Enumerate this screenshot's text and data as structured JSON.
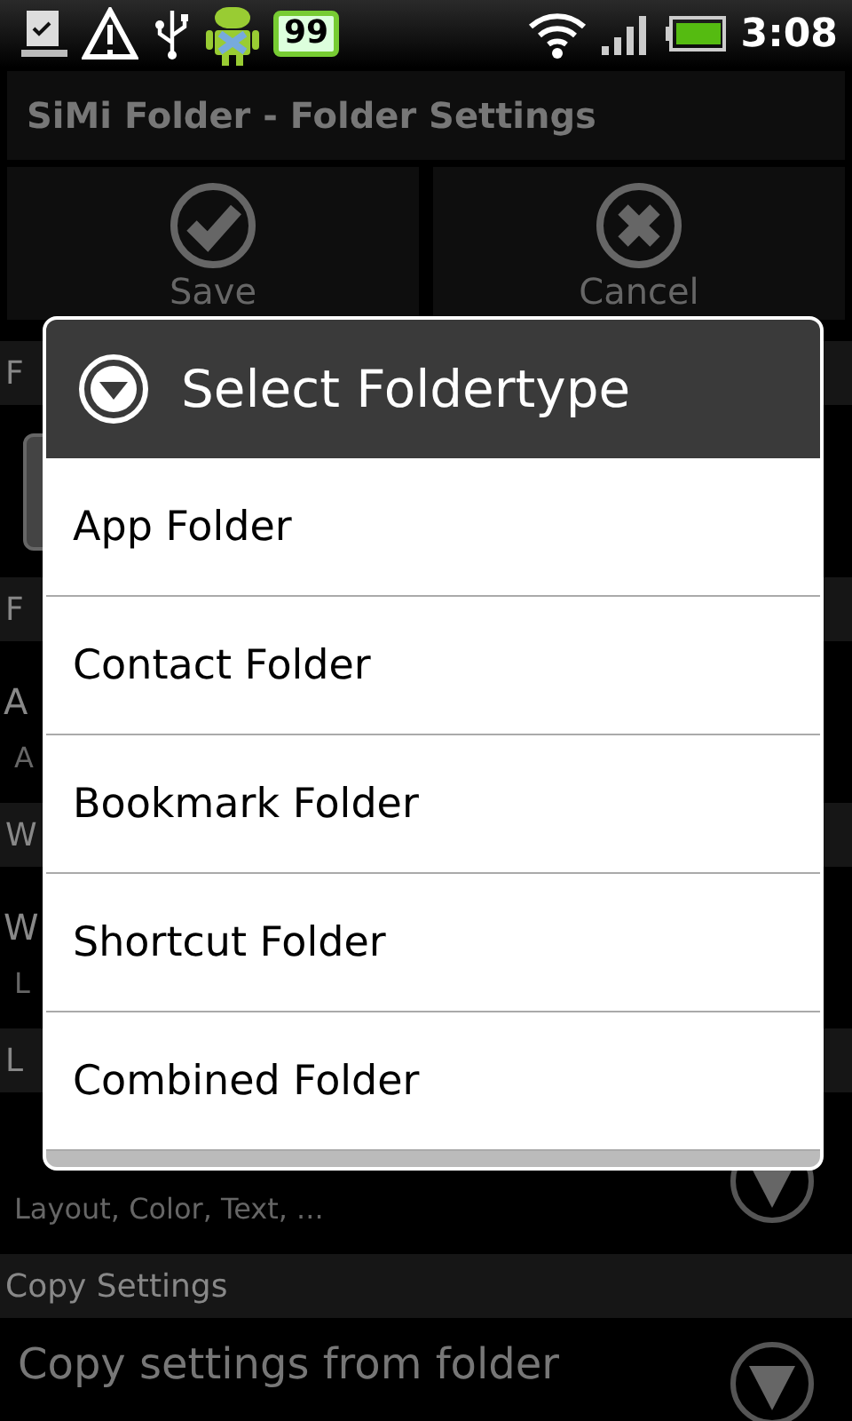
{
  "status_bar": {
    "battery_badge": "99",
    "time": "3:08"
  },
  "title": "SiMi Folder - Folder Settings",
  "actions": [
    {
      "kind": "save",
      "label": "Save"
    },
    {
      "kind": "cancel",
      "label": "Cancel"
    }
  ],
  "sections": [
    {
      "header": "F",
      "rows": [
        {
          "kind": "field"
        }
      ]
    },
    {
      "header": "F",
      "rows": [
        {
          "kind": "text",
          "title": "A",
          "summary": "A"
        }
      ]
    },
    {
      "header": "W",
      "rows": [
        {
          "kind": "text",
          "title": "W",
          "summary": "L"
        }
      ]
    },
    {
      "header": "L",
      "rows": [
        {
          "kind": "dropdown",
          "summary": "Layout, Color, Text, ..."
        }
      ]
    },
    {
      "header": "Copy Settings",
      "rows": [
        {
          "kind": "dropdown",
          "title": "Copy settings from folder"
        }
      ]
    }
  ],
  "dialog": {
    "title": "Select Foldertype",
    "options": [
      "App Folder",
      "Contact Folder",
      "Bookmark Folder",
      "Shortcut Folder",
      "Combined Folder"
    ]
  }
}
